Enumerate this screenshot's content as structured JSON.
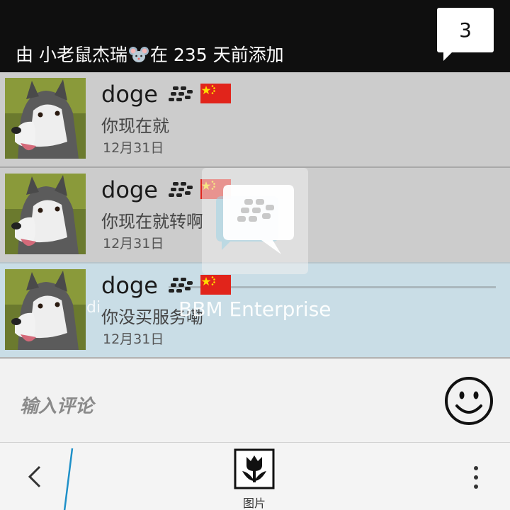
{
  "header": {
    "prefix": "由 小老鼠杰瑞",
    "mouse_emoji": "🐭",
    "suffix": "在 235 天前添加",
    "count": "3"
  },
  "comments": [
    {
      "name": "doge",
      "message": "你现在就",
      "date": "12月31日"
    },
    {
      "name": "doge",
      "message": "你现在就转啊",
      "date": "12月31日"
    },
    {
      "name": "doge",
      "message": "你没买服务嘞",
      "date": "12月31日"
    }
  ],
  "overlay": {
    "label": "BBM Enterprise",
    "ghost_text": "di"
  },
  "input": {
    "placeholder": "输入评论"
  },
  "bottom_bar": {
    "picture_label": "图片"
  },
  "icons": {
    "bbm_badge": "bbm-icon",
    "flag": "china-flag-icon",
    "smiley": "smiley-icon",
    "back": "chevron-left-icon",
    "picture": "tulip-icon",
    "more": "more-vertical-icon"
  },
  "colors": {
    "accent": "#1e90c8",
    "flag_red": "#e1241b",
    "flag_star": "#ffde00"
  }
}
